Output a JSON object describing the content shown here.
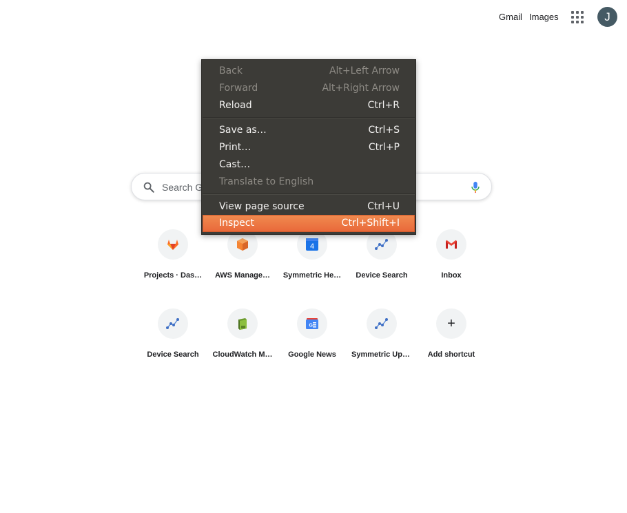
{
  "header": {
    "gmail_label": "Gmail",
    "images_label": "Images",
    "apps_icon": "apps-grid-icon",
    "avatar_initial": "J"
  },
  "search": {
    "placeholder": "Search Google or type a URL",
    "visible_text": "Search Go"
  },
  "shortcuts": [
    {
      "label": "Projects · Das…",
      "icon": "gitlab-icon"
    },
    {
      "label": "AWS Manage…",
      "icon": "aws-box-icon"
    },
    {
      "label": "Symmetric He…",
      "icon": "calendar-icon",
      "badge": "4"
    },
    {
      "label": "Device Search",
      "icon": "chart-line-icon"
    },
    {
      "label": "Inbox",
      "icon": "gmail-icon"
    },
    {
      "label": "Device Search",
      "icon": "chart-line-icon"
    },
    {
      "label": "CloudWatch M…",
      "icon": "cloudwatch-icon"
    },
    {
      "label": "Google News",
      "icon": "google-news-icon"
    },
    {
      "label": "Symmetric Upl…",
      "icon": "chart-line-icon"
    },
    {
      "label": "Add shortcut",
      "icon": "plus-icon",
      "glyph": "+"
    }
  ],
  "context_menu": {
    "items": [
      {
        "label": "Back",
        "shortcut": "Alt+Left Arrow",
        "disabled": true
      },
      {
        "label": "Forward",
        "shortcut": "Alt+Right Arrow",
        "disabled": true
      },
      {
        "label": "Reload",
        "shortcut": "Ctrl+R",
        "disabled": false
      },
      {
        "label": "Save as…",
        "shortcut": "Ctrl+S",
        "disabled": false
      },
      {
        "label": "Print…",
        "shortcut": "Ctrl+P",
        "disabled": false
      },
      {
        "label": "Cast…",
        "shortcut": "",
        "disabled": false
      },
      {
        "label": "Translate to English",
        "shortcut": "",
        "disabled": true
      },
      {
        "label": "View page source",
        "shortcut": "Ctrl+U",
        "disabled": false
      },
      {
        "label": "Inspect",
        "shortcut": "Ctrl+Shift+I",
        "disabled": false,
        "highlighted": true
      }
    ]
  },
  "colors": {
    "menu_bg": "#3c3b37",
    "menu_highlight": "#e9693a",
    "avatar_bg": "#455a64"
  }
}
